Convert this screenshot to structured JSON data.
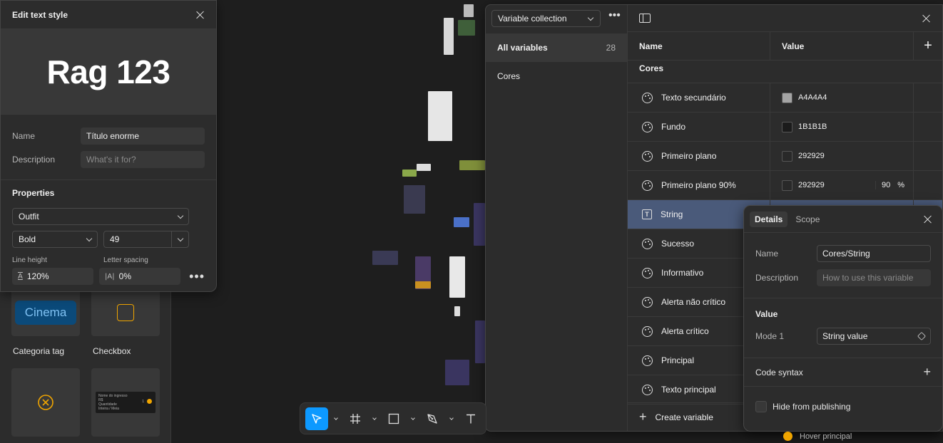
{
  "text_style": {
    "title": "Edit text style",
    "preview": "Rag 123",
    "name_label": "Name",
    "name_value": "Título enorme",
    "description_label": "Description",
    "description_placeholder": "What's it for?",
    "properties_title": "Properties",
    "font_family": "Outfit",
    "font_weight": "Bold",
    "font_size": "49",
    "line_height_label": "Line height",
    "line_height_value": "120%",
    "letter_spacing_label": "Letter spacing",
    "letter_spacing_value": "0%",
    "line_height_icon": "A",
    "letter_spacing_icon": "|A|"
  },
  "assets": {
    "items": [
      {
        "label": "Categoria tag",
        "preview_text": "Cinema"
      },
      {
        "label": "Checkbox"
      },
      {
        "label": ""
      },
      {
        "label": ""
      }
    ],
    "ticket": {
      "line1": "Nome do ingresso",
      "line2": "R$",
      "line3": "Quantidade",
      "line4": "Inteira / Meia",
      "count": "1"
    }
  },
  "variables": {
    "collection_select": "Variable collection",
    "groups": [
      {
        "label": "All variables",
        "count": "28"
      },
      {
        "label": "Cores",
        "count": ""
      }
    ],
    "table": {
      "name_header": "Name",
      "value_header": "Value",
      "group_heading": "Cores",
      "rows": [
        {
          "name": "Texto secundário",
          "value": "A4A4A4",
          "color": "#a4a4a4",
          "type": "color"
        },
        {
          "name": "Fundo",
          "value": "1B1B1B",
          "color": "#1b1b1b",
          "type": "color"
        },
        {
          "name": "Primeiro plano",
          "value": "292929",
          "color": "#292929",
          "type": "color"
        },
        {
          "name": "Primeiro plano 90%",
          "value": "292929",
          "color": "#292929",
          "type": "color",
          "opacity": "90",
          "opacity_sign": "%"
        },
        {
          "name": "String",
          "value": "",
          "type": "string"
        },
        {
          "name": "Sucesso",
          "value": "",
          "type": "color"
        },
        {
          "name": "Informativo",
          "value": "",
          "type": "color"
        },
        {
          "name": "Alerta não crítico",
          "value": "",
          "type": "color"
        },
        {
          "name": "Alerta crítico",
          "value": "",
          "type": "color"
        },
        {
          "name": "Principal",
          "value": "",
          "type": "color"
        },
        {
          "name": "Texto principal",
          "value": "",
          "type": "color"
        }
      ]
    },
    "create_label": "Create variable"
  },
  "details": {
    "tabs": [
      "Details",
      "Scope"
    ],
    "name_label": "Name",
    "name_value": "Cores/String",
    "description_label": "Description",
    "description_placeholder": "How to use this variable",
    "value_title": "Value",
    "mode_label": "Mode 1",
    "mode_value": "String value",
    "code_syntax_label": "Code syntax",
    "hide_label": "Hide from publishing"
  },
  "behind": {
    "hover_label": "Hover principal"
  },
  "colors": {
    "accent": "#0d99ff",
    "selected_row": "#4a5a7a",
    "brand_orange": "#f0a500"
  }
}
